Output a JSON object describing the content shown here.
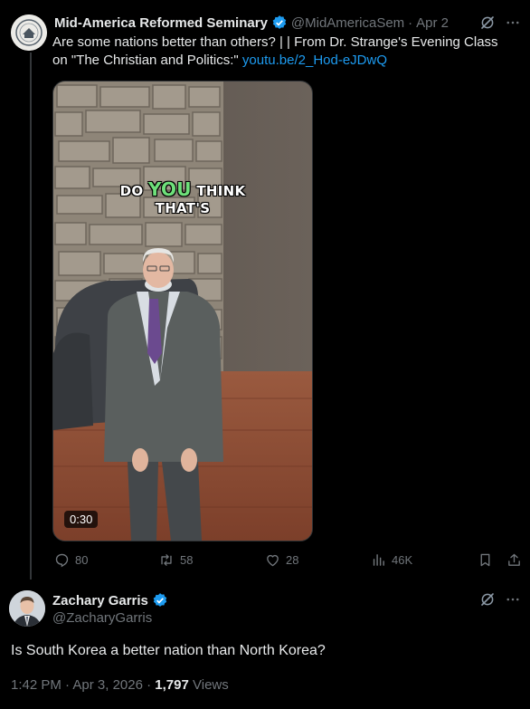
{
  "tweet1": {
    "author_name": "Mid-America Reformed Seminary",
    "handle": "@MidAmericaSem",
    "separator": "·",
    "date": "Apr 2",
    "text_line1": "Are some nations better than others? |  | From Dr. Strange's Evening Class",
    "text_line2": "on \"The Christian and Politics:\" ",
    "link": "youtu.be/2_Hod-eJDwQ",
    "video": {
      "caption_pre": "DO ",
      "caption_highlight": "YOU",
      "caption_post": " THINK",
      "caption_line2": "THAT'S",
      "duration": "0:30"
    },
    "actions": {
      "replies": "80",
      "reposts": "58",
      "likes": "28",
      "views": "46K"
    }
  },
  "tweet2": {
    "author_name": "Zachary Garris",
    "handle": "@ZacharyGarris",
    "text": "Is South Korea a better nation than North Korea?",
    "time": "1:42 PM",
    "separator": "·",
    "date": "Apr 3, 2026",
    "separator2": "·",
    "views_count": "1,797",
    "views_label": " Views"
  },
  "colors": {
    "background": "#000000",
    "text": "#e7e9ea",
    "muted": "#71767b",
    "link": "#1d9bf0",
    "verified": "#1d9bf0",
    "caption_highlight": "#6ee07a"
  },
  "icons": [
    "verified-badge-icon",
    "grok-icon",
    "more-icon",
    "reply-icon",
    "repost-icon",
    "like-icon",
    "views-icon",
    "bookmark-icon",
    "share-icon"
  ]
}
